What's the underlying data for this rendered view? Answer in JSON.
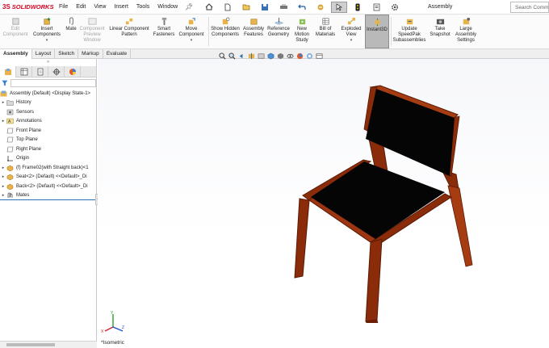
{
  "app": {
    "logo_ds": "3S",
    "logo_name": "SOLIDWORKS",
    "menus": [
      "File",
      "Edit",
      "View",
      "Insert",
      "Tools",
      "Window"
    ],
    "document_title": "Assembly",
    "search_placeholder": "Search Comm"
  },
  "ribbon": {
    "buttons": [
      {
        "label": "Edit Component",
        "disabled": true
      },
      {
        "label": "Insert Components",
        "disabled": false
      },
      {
        "label": "Mate",
        "disabled": false
      },
      {
        "label": "Component Preview Window",
        "disabled": true
      },
      {
        "label": "Linear Component Pattern",
        "disabled": false
      },
      {
        "label": "Smart Fasteners",
        "disabled": false
      },
      {
        "label": "Move Component",
        "disabled": false
      },
      {
        "label": "Show Hidden Components",
        "disabled": false
      },
      {
        "label": "Assembly Features",
        "disabled": false
      },
      {
        "label": "Reference Geometry",
        "disabled": false
      },
      {
        "label": "New Motion Study",
        "disabled": false
      },
      {
        "label": "Bill of Materials",
        "disabled": false
      },
      {
        "label": "Exploded View",
        "disabled": false
      },
      {
        "label": "Instant3D",
        "disabled": false,
        "active": true
      },
      {
        "label": "Update SpeedPak Subassemblies",
        "disabled": false
      },
      {
        "label": "Take Snapshot",
        "disabled": false
      },
      {
        "label": "Large Assembly Settings",
        "disabled": false
      }
    ]
  },
  "tabs": [
    "Assembly",
    "Layout",
    "Sketch",
    "Markup",
    "Evaluate"
  ],
  "feature_tree": {
    "root": "Assembly (Default) <Display State-1>",
    "items": [
      {
        "label": "History",
        "expandable": true
      },
      {
        "label": "Sensors",
        "expandable": false
      },
      {
        "label": "Annotations",
        "expandable": true
      },
      {
        "label": "Front Plane",
        "expandable": false
      },
      {
        "label": "Top Plane",
        "expandable": false
      },
      {
        "label": "Right Plane",
        "expandable": false
      },
      {
        "label": "Origin",
        "expandable": false
      },
      {
        "label": "(f) Frame02(with Straight back)<1",
        "expandable": true
      },
      {
        "label": "Seat<2> (Default) <<Default>_Di",
        "expandable": true
      },
      {
        "label": "Back<2> (Default) <<Default>_Di",
        "expandable": true
      },
      {
        "label": "Mates",
        "expandable": true
      }
    ]
  },
  "viewport": {
    "view_label": "*Isometric",
    "frame_color": "#8a2c0a",
    "seat_color": "#050505"
  }
}
